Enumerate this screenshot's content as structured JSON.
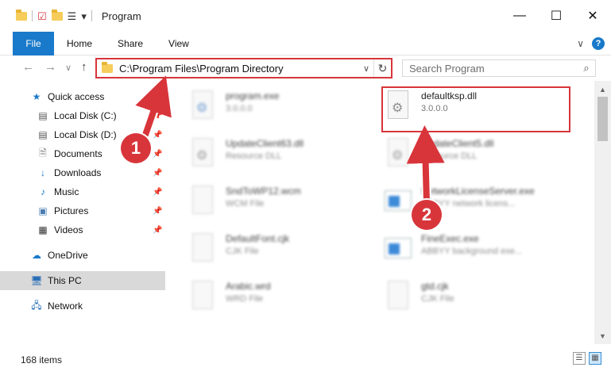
{
  "window": {
    "title": "Program",
    "controls": {
      "minimize": "—",
      "maximize": "☐",
      "close": "✕"
    }
  },
  "quick_access_toolbar": {
    "dropdown": "▾"
  },
  "ribbon": {
    "tabs": [
      "File",
      "Home",
      "Share",
      "View"
    ],
    "collapse": "∨",
    "help": "?"
  },
  "navigation": {
    "back": "←",
    "forward": "→",
    "recent": "∨",
    "up": "↑"
  },
  "address_bar": {
    "path": "C:\\Program Files\\Program Directory",
    "dropdown": "∨",
    "refresh": "↻"
  },
  "search": {
    "placeholder": "Search Program",
    "icon": "⌕"
  },
  "nav_pane": {
    "items": [
      {
        "label": "Quick access",
        "icon": "star-icon",
        "pinned": false
      },
      {
        "label": "Local Disk (C:)",
        "icon": "drive-icon",
        "pinned": true
      },
      {
        "label": "Local Disk (D:)",
        "icon": "drive-icon",
        "pinned": true
      },
      {
        "label": "Documents",
        "icon": "documents-icon",
        "pinned": true
      },
      {
        "label": "Downloads",
        "icon": "download-icon",
        "pinned": true
      },
      {
        "label": "Music",
        "icon": "music-icon",
        "pinned": true
      },
      {
        "label": "Pictures",
        "icon": "pictures-icon",
        "pinned": true
      },
      {
        "label": "Videos",
        "icon": "videos-icon",
        "pinned": true
      },
      {
        "label": "OneDrive",
        "icon": "cloud-icon",
        "pinned": false
      },
      {
        "label": "This PC",
        "icon": "computer-icon",
        "pinned": false,
        "selected": true
      },
      {
        "label": "Network",
        "icon": "network-icon",
        "pinned": false
      }
    ]
  },
  "files": [
    {
      "name": "program.exe",
      "detail": "3.0.0.0",
      "icon": "exe-icon",
      "blurred": true
    },
    {
      "name": "defaultksp.dll",
      "detail": "3.0.0.0",
      "icon": "dll-icon",
      "blurred": false,
      "highlighted": true
    },
    {
      "name": "UpdateClient63.dll",
      "detail": "Resource DLL",
      "icon": "dll-icon",
      "blurred": true
    },
    {
      "name": "UpdateClient5.dll",
      "detail": "Resource DLL",
      "icon": "dll-icon",
      "blurred": true
    },
    {
      "name": "SndToWP12.wcm",
      "detail": "WCM File",
      "icon": "file-icon",
      "blurred": true
    },
    {
      "name": "NetworkLicenseServer.exe",
      "detail": "ABBYY network licens...",
      "icon": "app-icon",
      "blurred": true
    },
    {
      "name": "DefaultFont.cjk",
      "detail": "CJK File",
      "icon": "file-icon",
      "blurred": true
    },
    {
      "name": "FineExec.exe",
      "detail": "ABBYY background exe...",
      "icon": "app-icon",
      "blurred": true
    },
    {
      "name": "Arabic.wrd",
      "detail": "WRD File",
      "icon": "file-icon",
      "blurred": true
    },
    {
      "name": "gtd.cjk",
      "detail": "CJK File",
      "icon": "file-icon",
      "blurred": true
    }
  ],
  "status": {
    "item_count": "168 items"
  },
  "annotations": {
    "step1": "1",
    "step2": "2"
  },
  "colors": {
    "accent": "#1979ca",
    "annotation": "#d8353b",
    "selected_nav": "#d9d9d9"
  }
}
